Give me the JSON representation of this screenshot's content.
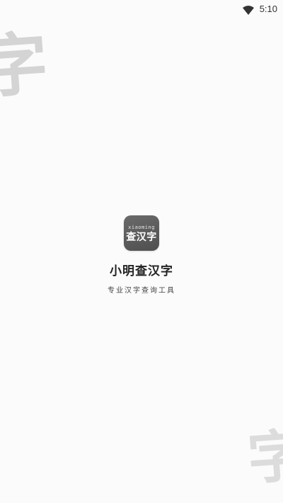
{
  "status_bar": {
    "time": "5:10",
    "wifi_icon": "wifi-icon"
  },
  "watermarks": {
    "top_char": "字",
    "bottom_char": "字"
  },
  "app": {
    "icon_small_text": "xiaoming",
    "icon_big_text": "查汉字",
    "title": "小明查汉字",
    "subtitle": "专业汉字查询工具"
  },
  "colors": {
    "background": "#fbfbfb",
    "icon_bg": "#5a5a5a",
    "watermark": "#d8d8d8"
  }
}
